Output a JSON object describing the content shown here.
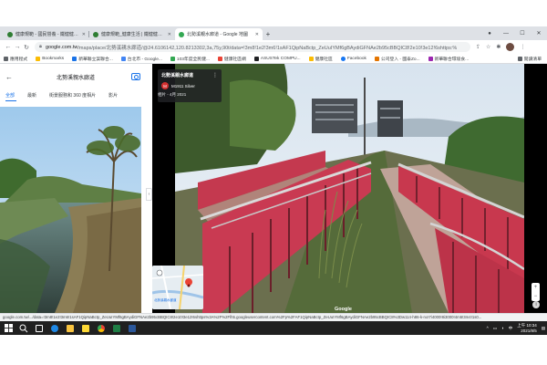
{
  "browser": {
    "tabs": [
      {
        "title": "健康規範 - 國民營養 - 鐵健健康行",
        "fav_color": "#2e7d32",
        "active": false
      },
      {
        "title": "健康規範_健康生活 | 鐵健健康行",
        "fav_color": "#2e7d32",
        "active": false
      },
      {
        "title": "北勢溪親水廊道 - Google 地圖",
        "fav_color": "#34a853",
        "active": true
      }
    ],
    "new_tab": "+",
    "url_host": "google.com.tw",
    "url_path": "/maps/place/北勢溪親水廊道/@24.6106142,120.8213302,3a,75y,90t/data=!3m8!1e2!3m6!1sAF1QipNaBctp_ZeUuIYMf6gBAydiGFNAe2b95cBBQIC8!2e10!3e12!6shttps:%",
    "bookmarks": [
      {
        "label": "應用程式",
        "color": "#5f6368"
      },
      {
        "label": "Bookmarks",
        "color": "#fbbc04"
      },
      {
        "label": "新華聯立案聯合...",
        "color": "#1a73e8"
      },
      {
        "label": "台北市 - Google...",
        "color": "#4285f4"
      },
      {
        "label": "103年度全民健...",
        "color": "#34a853"
      },
      {
        "label": "健康社區網",
        "color": "#ea4335"
      },
      {
        "label": "ASUSTek COMPU...",
        "color": "#202124"
      },
      {
        "label": "健康社區",
        "color": "#fbbc04"
      },
      {
        "label": "Facebook",
        "color": "#1877f2"
      },
      {
        "label": "公司登入 - 國泰Zo...",
        "color": "#e37400"
      },
      {
        "label": "新華聯合環境食...",
        "color": "#9c27b0"
      }
    ],
    "reading_list": "閱讀清單"
  },
  "panel": {
    "title": "北勢溪親水廊道",
    "tabs": [
      "全部",
      "最新",
      "街景服務和 360 度相片",
      "影片"
    ],
    "active_tab": "全部"
  },
  "viewer": {
    "place_name": "北勢溪親水廊道",
    "author_initial": "M",
    "author": "M1911 Silver",
    "date": "相片 - 4月 2021",
    "google_logo": "Google",
    "info": "i",
    "zoom_in": "+",
    "zoom_out": "−",
    "minimap_label": "北勢溪親水廊道"
  },
  "status_url": "google.com.tw/.../data=!3m8!1e2!3m6!1sAF1QipNaBctp_ZeUuIYMf6gBAydiGFNAe2b95cBBQIC8!2e10!3e12!6shttps%3A%2F%2Flh5.googleusercontent.com%2Fp%2FAF1QipNaBctp_ZeUuIYMf6gBAydiGFNAe2b95cBBQIC8%3Dw114-h86-k-no!7i4000!8i3000!4m5!3m4!1s0...",
  "taskbar": {
    "time": "上午 10:34",
    "date": "2021/8/5",
    "lang": "中"
  }
}
